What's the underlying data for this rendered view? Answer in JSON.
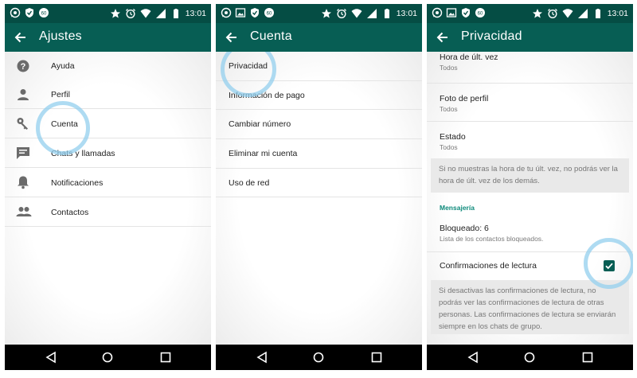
{
  "status_bar": {
    "time": "13:01"
  },
  "screens": [
    {
      "title": "Ajustes",
      "items": [
        {
          "label": "Ayuda",
          "icon": "help-icon"
        },
        {
          "label": "Perfil",
          "icon": "person-icon"
        },
        {
          "label": "Cuenta",
          "icon": "key-icon"
        },
        {
          "label": "Chats y llamadas",
          "icon": "chat-icon"
        },
        {
          "label": "Notificaciones",
          "icon": "bell-icon"
        },
        {
          "label": "Contactos",
          "icon": "contacts-icon"
        }
      ]
    },
    {
      "title": "Cuenta",
      "items": [
        {
          "label": "Privacidad"
        },
        {
          "label": "Información de pago"
        },
        {
          "label": "Cambiar número"
        },
        {
          "label": "Eliminar mi cuenta"
        },
        {
          "label": "Uso de red"
        }
      ]
    },
    {
      "title": "Privacidad",
      "prefs": [
        {
          "title": "Hora de últ. vez",
          "subtitle": "Todos"
        },
        {
          "title": "Foto de perfil",
          "subtitle": "Todos"
        },
        {
          "title": "Estado",
          "subtitle": "Todos"
        }
      ],
      "note1": "Si no muestras la hora de tu últ. vez, no podrás ver la hora de últ. vez de los demás.",
      "section": "Mensajería",
      "blocked": {
        "title": "Bloqueado: 6",
        "subtitle": "Lista de los contactos bloqueados."
      },
      "read_receipts": {
        "label": "Confirmaciones de lectura",
        "checked": true
      },
      "note2": "Si desactivas las confirmaciones de lectura, no podrás ver las confirmaciones de lectura de otras personas. Las confirmaciones de lectura se enviarán siempre en los chats de grupo."
    }
  ],
  "colors": {
    "toolbar": "#075e54",
    "status_bar": "#054d44",
    "accent": "#0e8a7b",
    "focus_ring": "#93cfee"
  }
}
